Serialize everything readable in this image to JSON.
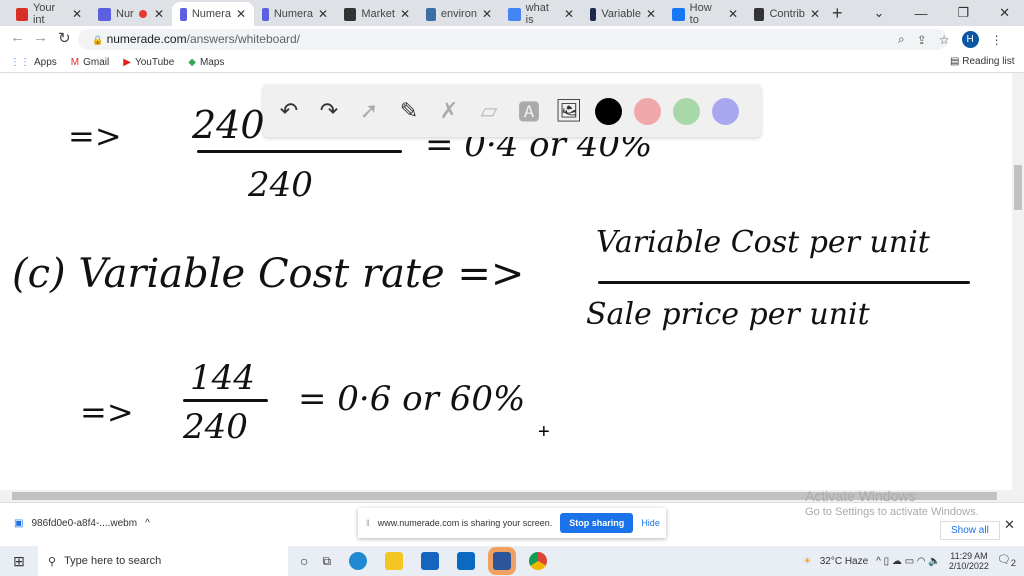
{
  "browser": {
    "tabs": [
      {
        "title": "Your int",
        "icon": "gmail-icon",
        "color": "#d93025"
      },
      {
        "title": "Nur",
        "icon": "numerade-icon",
        "color": "#5b5fe0",
        "recording": true
      },
      {
        "title": "Numera",
        "icon": "numerade-icon",
        "color": "#5b5fe0",
        "active": true
      },
      {
        "title": "Numera",
        "icon": "numerade-icon",
        "color": "#5b5fe0"
      },
      {
        "title": "Market",
        "icon": "market-icon",
        "color": "#333333"
      },
      {
        "title": "environ",
        "icon": "environ-icon",
        "color": "#3a6ea5"
      },
      {
        "title": "what is",
        "icon": "google-icon",
        "color": "#4285f4"
      },
      {
        "title": "Variable",
        "icon": "variable-icon",
        "color": "#1b2a4a"
      },
      {
        "title": "How to",
        "icon": "f-icon",
        "color": "#1877f2"
      },
      {
        "title": "Contrib",
        "icon": "market-icon",
        "color": "#333333"
      }
    ],
    "url_domain": "numerade.com",
    "url_path": "/answers/whiteboard/",
    "profile_initial": "H",
    "bookmarks": [
      "Apps",
      "Gmail",
      "YouTube",
      "Maps"
    ],
    "reading_list": "Reading list"
  },
  "whiteboard": {
    "line1": {
      "arrow": "=>",
      "numerator": "240",
      "denominator": "240",
      "result": "= 0·4  or  40%"
    },
    "line2": {
      "label": "(c)  Variable  Cost  rate  =>",
      "numerator": "Variable  Cost per unit",
      "denominator": "Sale price per unit"
    },
    "line3": {
      "arrow": "=>",
      "numerator": "144",
      "denominator": "240",
      "result": "= 0·6  or  60%"
    },
    "toolbar": [
      "undo",
      "redo",
      "select",
      "pen",
      "tools",
      "eraser",
      "text",
      "image"
    ],
    "colors": [
      "#000000",
      "#f0a8a8",
      "#a8d8a8",
      "#a8a8f0"
    ]
  },
  "downloads": {
    "file": "986fd0e0-a8f4-....webm",
    "show_all": "Show all"
  },
  "sharing": {
    "message": "www.numerade.com is sharing your screen.",
    "stop": "Stop sharing",
    "hide": "Hide"
  },
  "watermark": {
    "title": "Activate Windows",
    "subtitle": "Go to Settings to activate Windows."
  },
  "taskbar": {
    "search_placeholder": "Type here to search",
    "weather": "32°C  Haze",
    "time": "11:29 AM",
    "date": "2/10/2022",
    "notifications": "2"
  }
}
